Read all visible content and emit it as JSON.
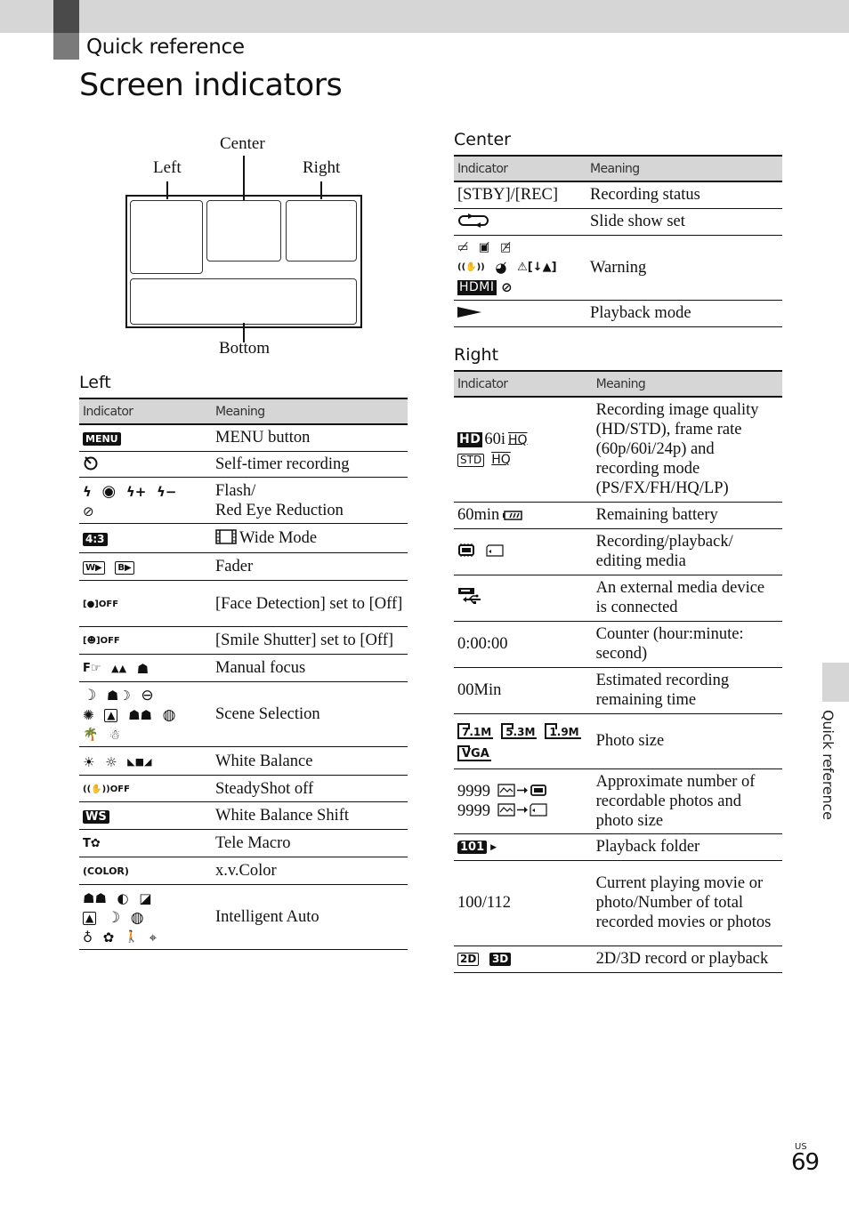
{
  "header": {
    "section": "Quick reference",
    "title": "Screen indicators"
  },
  "diagram": {
    "labels": {
      "left": "Left",
      "center": "Center",
      "right": "Right",
      "bottom": "Bottom"
    }
  },
  "tables": {
    "column_indicator": "Indicator",
    "column_meaning": "Meaning",
    "left": {
      "title": "Left",
      "rows": [
        {
          "indicator_icons": [
            [
              "MENU"
            ]
          ],
          "icon_names": [
            "menu-icon"
          ],
          "meaning": "MENU button"
        },
        {
          "indicator_icons": [
            [
              "⏲"
            ]
          ],
          "icon_names": [
            "self-timer-icon"
          ],
          "meaning": "Self-timer recording"
        },
        {
          "indicator_icons": [
            [
              "ϟ",
              "◉",
              "ϟ+",
              "ϟ−"
            ],
            [
              "⊘"
            ]
          ],
          "icon_names": [
            "flash-auto-icon",
            "red-eye-icon",
            "flash-plus-icon",
            "flash-minus-icon",
            "flash-off-icon"
          ],
          "meaning": "Flash/\nRed Eye Reduction"
        },
        {
          "indicator_icons": [
            [
              "4:3"
            ]
          ],
          "icon_names": [
            "aspect-4-3-icon"
          ],
          "meaning_prefix_icon": "film-frame-icon",
          "meaning": "Wide Mode"
        },
        {
          "indicator_icons": [
            [
              "W▶",
              "B▶"
            ]
          ],
          "icon_names": [
            "fader-white-icon",
            "fader-black-icon"
          ],
          "meaning": "Fader"
        },
        {
          "indicator_icons": [
            [
              "[●]OFF"
            ]
          ],
          "icon_names": [
            "face-detection-off-icon"
          ],
          "meaning": "[Face Detection] set to [Off]"
        },
        {
          "indicator_icons": [
            [
              "[☻]OFF"
            ]
          ],
          "icon_names": [
            "smile-shutter-off-icon"
          ],
          "meaning": "[Smile Shutter] set to [Off]"
        },
        {
          "indicator_icons": [
            [
              "F☞",
              "▲▲",
              "☗"
            ]
          ],
          "icon_names": [
            "manual-focus-icon",
            "infinity-focus-icon",
            "near-focus-icon"
          ],
          "meaning": "Manual focus"
        },
        {
          "indicator_icons": [
            [
              "☽",
              "☗☽",
              "⊖"
            ],
            [
              "✺",
              "▲",
              "☗☗",
              "◍"
            ],
            [
              "🌴",
              "☃"
            ]
          ],
          "icon_names": [
            "night-scene-icon",
            "night-portrait-icon",
            "sunrise-sunset-icon",
            "fireworks-icon",
            "landscape-icon",
            "portrait-icon",
            "spotlight-icon",
            "beach-icon",
            "snow-icon"
          ],
          "meaning": "Scene Selection"
        },
        {
          "indicator_icons": [
            [
              "☀",
              "☼",
              "◣■◢"
            ]
          ],
          "icon_names": [
            "outdoor-wb-icon",
            "indoor-wb-icon",
            "one-push-wb-icon"
          ],
          "meaning": "White Balance"
        },
        {
          "indicator_icons": [
            [
              "((✋))OFF"
            ]
          ],
          "icon_names": [
            "steadyshot-off-icon"
          ],
          "meaning": "SteadyShot off"
        },
        {
          "indicator_icons": [
            [
              "WS"
            ]
          ],
          "icon_names": [
            "wb-shift-icon"
          ],
          "meaning": "White Balance Shift"
        },
        {
          "indicator_icons": [
            [
              "T✿"
            ]
          ],
          "icon_names": [
            "tele-macro-icon"
          ],
          "meaning": "Tele Macro"
        },
        {
          "indicator_icons": [
            [
              "(COLOR)"
            ]
          ],
          "icon_names": [
            "xv-color-icon"
          ],
          "meaning": "x.v.Color"
        },
        {
          "indicator_icons": [
            [
              "☗☗",
              "◐",
              "◪"
            ],
            [
              "▲",
              "☽",
              "◍"
            ],
            [
              "♁",
              "✿",
              "🚶",
              "⌖"
            ]
          ],
          "icon_names": [
            "portrait-icon",
            "baby-icon",
            "backlight-icon",
            "landscape-icon",
            "night-scene-icon",
            "spotlight-icon",
            "low-light-icon",
            "macro-icon",
            "walking-icon",
            "tripod-icon"
          ],
          "meaning": "Intelligent Auto"
        }
      ]
    },
    "center": {
      "title": "Center",
      "rows": [
        {
          "indicator_text": "[STBY]/[REC]",
          "meaning": "Recording status"
        },
        {
          "indicator_icons": [
            [
              "⟲"
            ]
          ],
          "icon_names": [
            "slide-show-icon"
          ],
          "meaning": "Slide show set"
        },
        {
          "indicator_icons": [
            [
              "▭̸",
              "▣̸",
              "◳̸"
            ],
            [
              "((✋))",
              "◕̸",
              "⚠[↓▲]"
            ],
            [
              "HDMI",
              "⊘"
            ]
          ],
          "icon_names": [
            "battery-warning-icon",
            "memory-warning-icon",
            "card-warning-icon",
            "camera-shake-icon",
            "media-warning-icon",
            "overheat-warning-icon",
            "hdmi-icon",
            "prohibited-icon"
          ],
          "meaning": "Warning"
        },
        {
          "indicator_icons": [
            [
              "▶"
            ]
          ],
          "icon_names": [
            "playback-icon"
          ],
          "meaning": "Playback mode"
        }
      ]
    },
    "right": {
      "title": "Right",
      "rows": [
        {
          "indicator_lines": [
            [
              "HD",
              "60i",
              "HQ"
            ],
            [
              "STD",
              "HQ"
            ]
          ],
          "icon_names": [
            "hd-quality-icon",
            "std-quality-icon"
          ],
          "meaning": "Recording image quality (HD/STD), frame rate (60p/60i/24p) and recording mode (PS/FX/FH/HQ/LP)"
        },
        {
          "indicator_text": "60min",
          "icon_names": [
            "battery-icon"
          ],
          "meaning": "Remaining battery"
        },
        {
          "icon_names": [
            "internal-memory-icon",
            "memory-card-icon"
          ],
          "meaning": "Recording/playback/\nediting media"
        },
        {
          "icon_names": [
            "external-usb-media-icon"
          ],
          "meaning": "An external media device is connected"
        },
        {
          "indicator_text": "0:00:00",
          "meaning": "Counter (hour:minute: second)"
        },
        {
          "indicator_text": "00Min",
          "meaning": "Estimated recording remaining time"
        },
        {
          "indicator_photo_sizes": [
            "7.1M",
            "5.3M",
            "1.9M",
            "VGA"
          ],
          "icon_names": [
            "photo-size-icon"
          ],
          "meaning": "Photo size"
        },
        {
          "indicator_lines": [
            [
              "9999"
            ],
            [
              "9999"
            ]
          ],
          "icon_names": [
            "photo-to-memory-icon",
            "photo-to-card-icon"
          ],
          "meaning": "Approximate number of recordable photos and photo size"
        },
        {
          "indicator_text": "101",
          "icon_names": [
            "playback-folder-icon"
          ],
          "meaning": "Playback folder"
        },
        {
          "indicator_text": "100/112",
          "meaning": "Current playing movie or photo/Number of total recorded movies or photos"
        },
        {
          "indicator_icons": [
            [
              "2D",
              "3D"
            ]
          ],
          "icon_names": [
            "2d-icon",
            "3d-icon"
          ],
          "meaning": "2D/3D record or playback"
        }
      ]
    }
  },
  "side_tab": "Quick reference",
  "footer": {
    "region": "US",
    "page_number": "69"
  }
}
